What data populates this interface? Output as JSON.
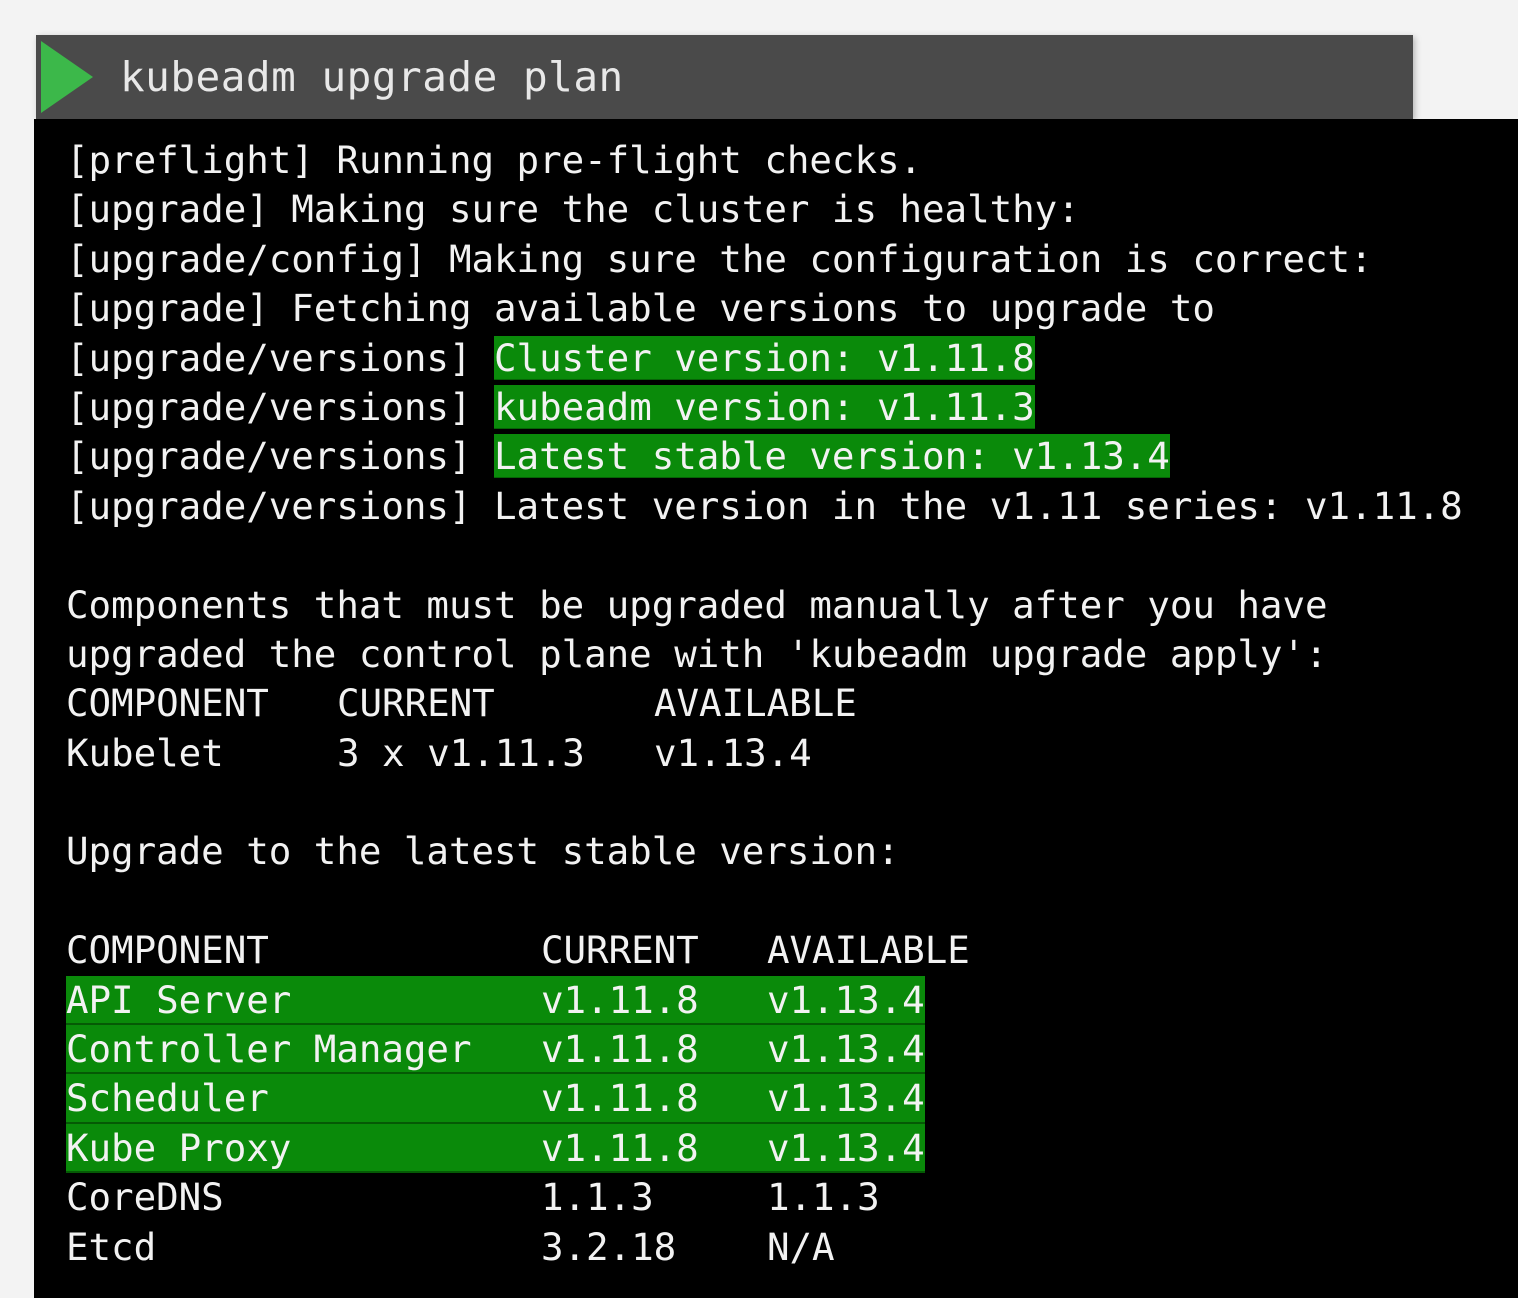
{
  "header": {
    "icon": "play-triangle-icon",
    "command": "kubeadm upgrade plan"
  },
  "colors": {
    "highlight": "#0a8a0a",
    "header_bg": "#4a4a4a",
    "play_icon": "#3cb84a",
    "terminal_bg": "#000000",
    "text": "#f2f2f2"
  },
  "log": [
    {
      "prefix": "[preflight]",
      "message": "Running pre-flight checks.",
      "highlight": false
    },
    {
      "prefix": "[upgrade]",
      "message": "Making sure the cluster is healthy:",
      "highlight": false
    },
    {
      "prefix": "[upgrade/config]",
      "message": "Making sure the configuration is correct:",
      "highlight": false
    },
    {
      "prefix": "[upgrade]",
      "message": "Fetching available versions to upgrade to",
      "highlight": false
    },
    {
      "prefix": "[upgrade/versions]",
      "message": "Cluster version: v1.11.8",
      "highlight": true
    },
    {
      "prefix": "[upgrade/versions]",
      "message": "kubeadm version: v1.11.3",
      "highlight": true
    },
    {
      "prefix": "[upgrade/versions]",
      "message": "Latest stable version: v1.13.4",
      "highlight": true
    },
    {
      "prefix": "[upgrade/versions]",
      "message": "Latest version in the v1.11 series: v1.11.8",
      "highlight": false
    }
  ],
  "manual_section": {
    "intro_line_1": "Components that must be upgraded manually after you have",
    "intro_line_2": "upgraded the control plane with 'kubeadm upgrade apply':",
    "headers": [
      "COMPONENT",
      "CURRENT",
      "AVAILABLE"
    ],
    "rows": [
      {
        "component": "Kubelet",
        "current": "3 x v1.11.3",
        "available": "v1.13.4"
      }
    ]
  },
  "upgrade_section": {
    "title": "Upgrade to the latest stable version:",
    "headers": [
      "COMPONENT",
      "CURRENT",
      "AVAILABLE"
    ],
    "rows": [
      {
        "component": "API Server",
        "current": "v1.11.8",
        "available": "v1.13.4",
        "highlight": true
      },
      {
        "component": "Controller Manager",
        "current": "v1.11.8",
        "available": "v1.13.4",
        "highlight": true
      },
      {
        "component": "Scheduler",
        "current": "v1.11.8",
        "available": "v1.13.4",
        "highlight": true
      },
      {
        "component": "Kube Proxy",
        "current": "v1.11.8",
        "available": "v1.13.4",
        "highlight": true
      },
      {
        "component": "CoreDNS",
        "current": "1.1.3",
        "available": "1.1.3",
        "highlight": false
      },
      {
        "component": "Etcd",
        "current": "3.2.18",
        "available": "N/A",
        "highlight": false
      }
    ]
  }
}
